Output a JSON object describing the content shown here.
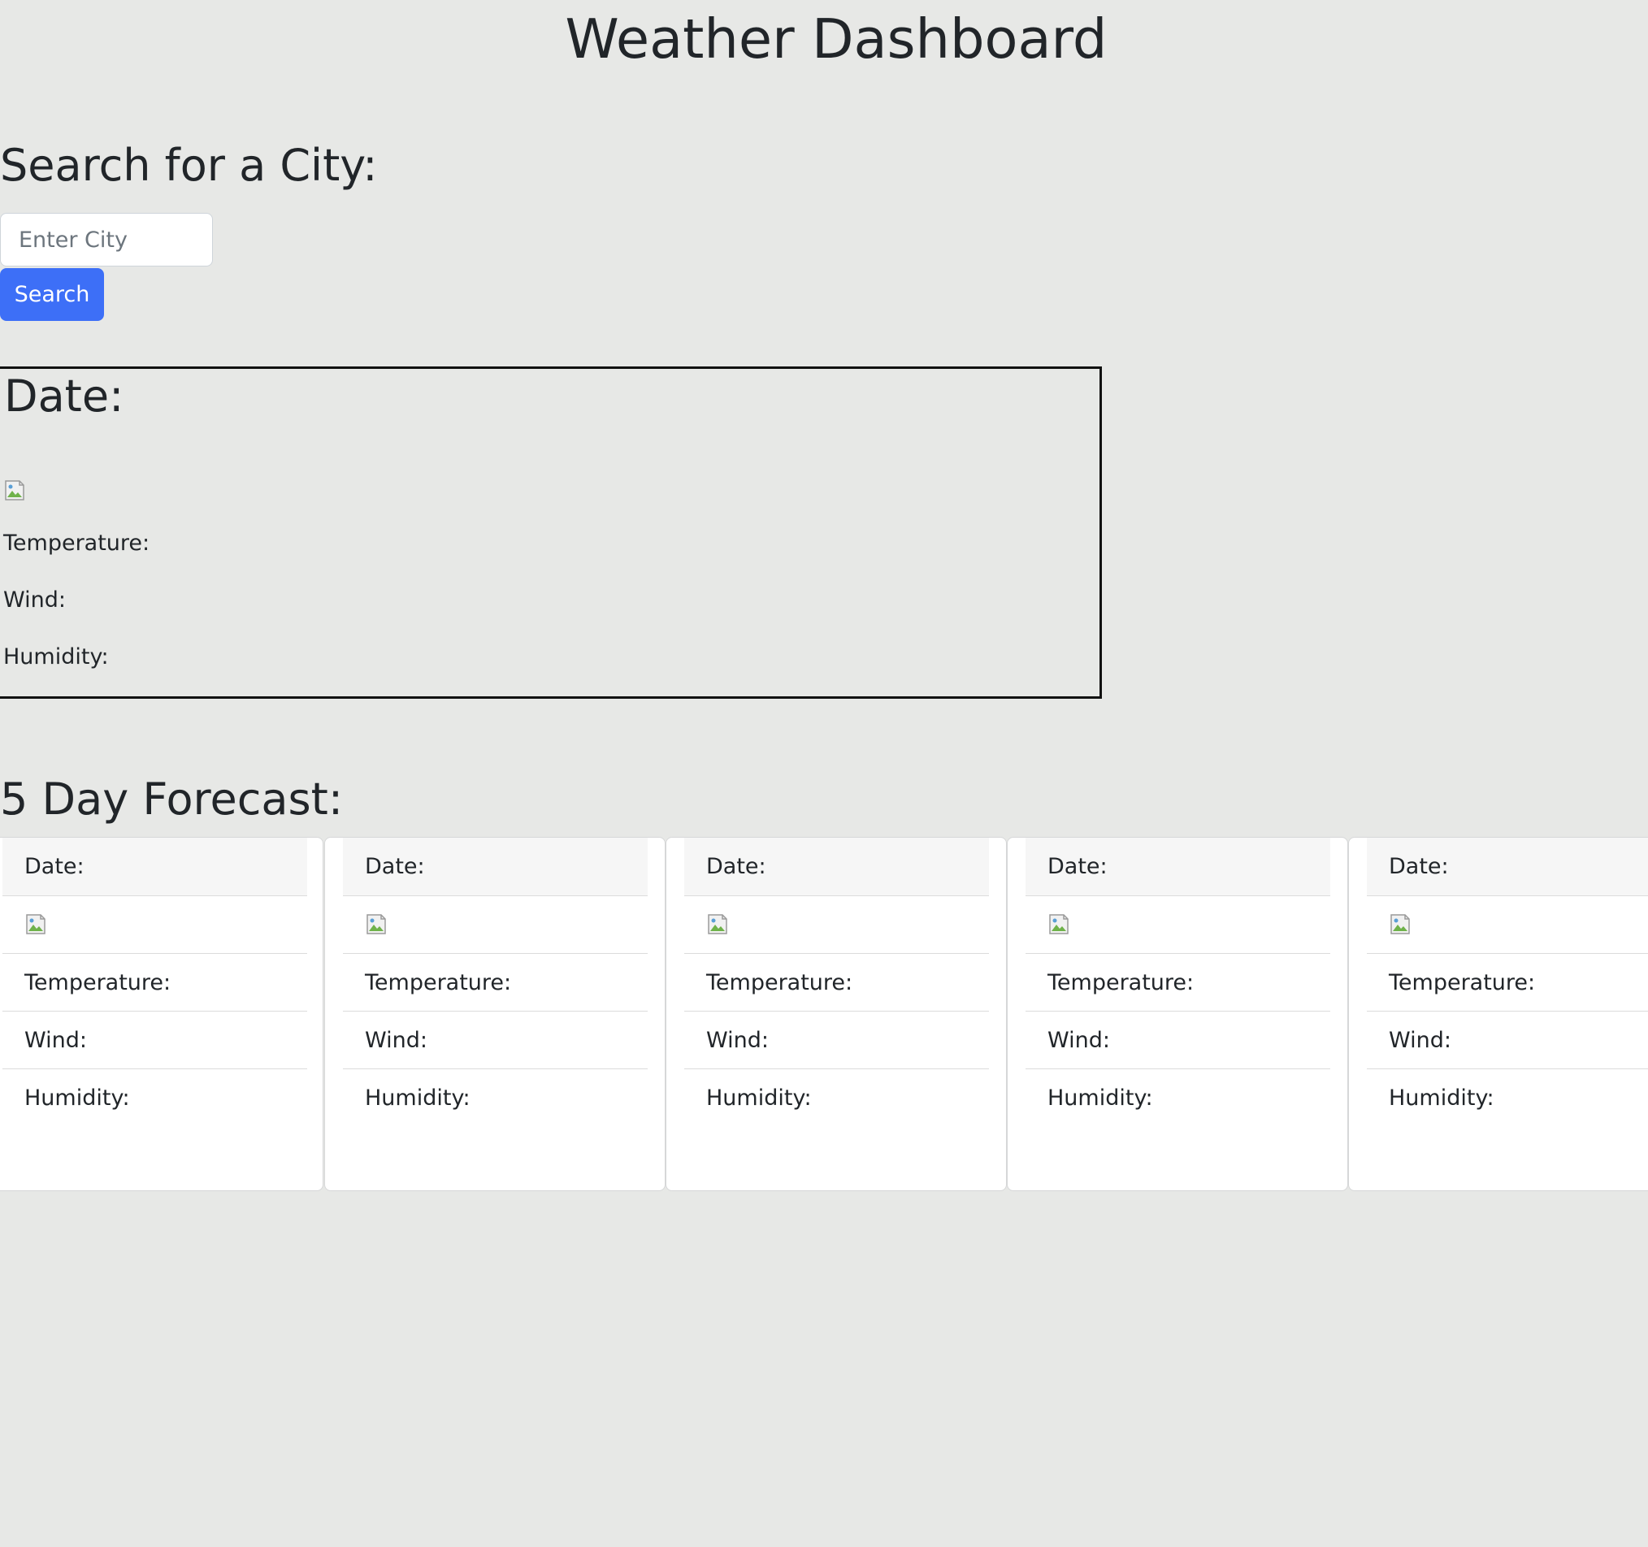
{
  "page": {
    "title": "Weather Dashboard"
  },
  "search": {
    "heading": "Search for a City:",
    "placeholder": "Enter City",
    "value": "",
    "button_label": "Search"
  },
  "current": {
    "date_label": "Date:",
    "icon": "broken-image-icon",
    "temperature_label": "Temperature:",
    "wind_label": "Wind:",
    "humidity_label": "Humidity:"
  },
  "forecast": {
    "heading": "5 Day Forecast:",
    "cards": [
      {
        "date_label": "Date:",
        "icon": "broken-image-icon",
        "temperature_label": "Temperature:",
        "wind_label": "Wind:",
        "humidity_label": "Humidity:"
      },
      {
        "date_label": "Date:",
        "icon": "broken-image-icon",
        "temperature_label": "Temperature:",
        "wind_label": "Wind:",
        "humidity_label": "Humidity:"
      },
      {
        "date_label": "Date:",
        "icon": "broken-image-icon",
        "temperature_label": "Temperature:",
        "wind_label": "Wind:",
        "humidity_label": "Humidity:"
      },
      {
        "date_label": "Date:",
        "icon": "broken-image-icon",
        "temperature_label": "Temperature:",
        "wind_label": "Wind:",
        "humidity_label": "Humidity:"
      },
      {
        "date_label": "Date:",
        "icon": "broken-image-icon",
        "temperature_label": "Temperature:",
        "wind_label": "Wind:",
        "humidity_label": "Humidity:"
      }
    ]
  },
  "colors": {
    "page_background": "#e7e8e6",
    "text": "#212529",
    "button_primary": "#3d6ff7",
    "button_text": "#ffffff",
    "card_background": "#ffffff",
    "card_header_background": "#f6f6f6",
    "current_border": "#111111"
  }
}
